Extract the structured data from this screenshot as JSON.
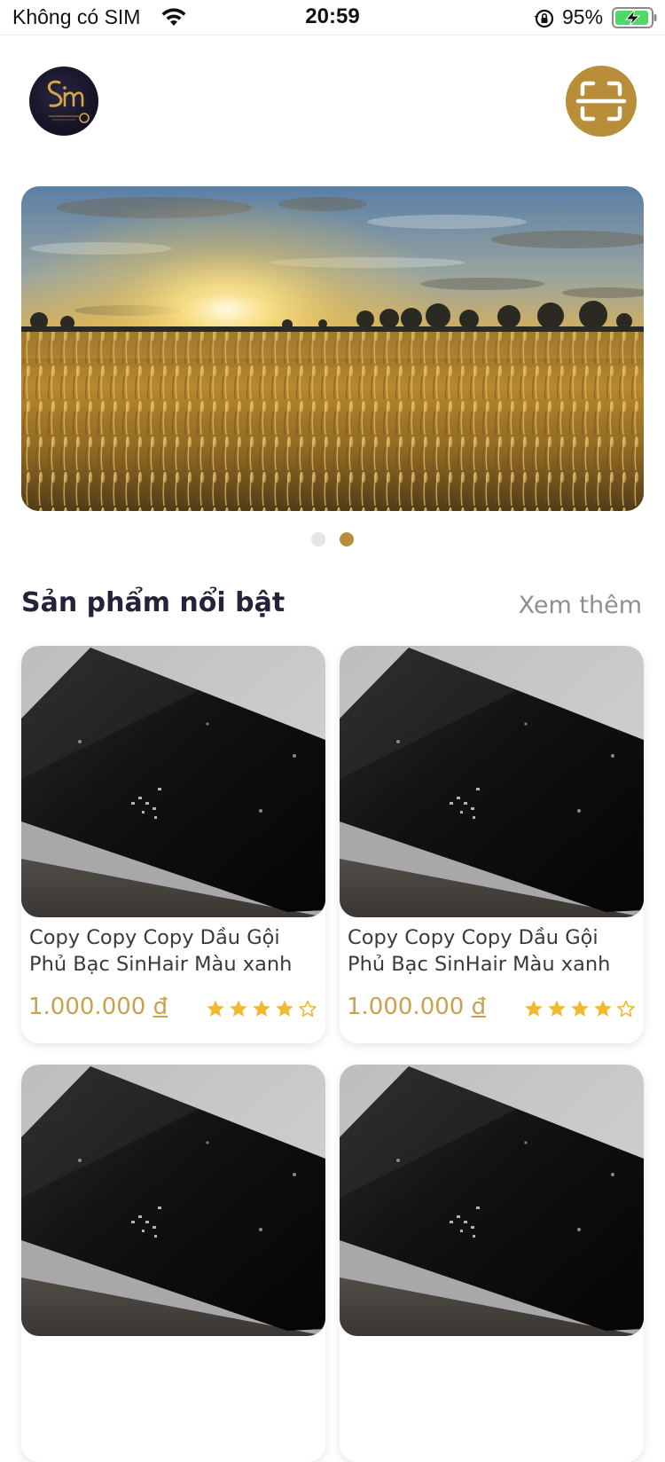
{
  "status_bar": {
    "carrier": "Không có SIM",
    "time": "20:59",
    "battery_percent": "95%",
    "battery_level": 0.95
  },
  "header": {
    "logo_icon": "sinhair-logo-icon",
    "scan_icon": "scan-icon"
  },
  "banner": {
    "image": "wheat-field-sunset",
    "pages": 2,
    "active_page": 2
  },
  "featured": {
    "title": "Sản phẩm nổi bật",
    "see_more": "Xem thêm",
    "products": [
      {
        "name": "Copy Copy Copy Dầu Gội Phủ Bạc SinHair Màu xanh",
        "price": "1.000.000",
        "currency": "đ",
        "rating": 4
      },
      {
        "name": "Copy Copy Copy Dầu Gội Phủ Bạc SinHair Màu xanh",
        "price": "1.000.000",
        "currency": "đ",
        "rating": 4
      },
      {
        "name": "",
        "price": "",
        "currency": "",
        "rating": 0
      },
      {
        "name": "",
        "price": "",
        "currency": "",
        "rating": 0
      }
    ]
  },
  "colors": {
    "accent": "#b98e3a",
    "price": "#c9a24d",
    "title": "#25223a",
    "muted": "#8f8f8f",
    "star": "#f2b92e"
  }
}
